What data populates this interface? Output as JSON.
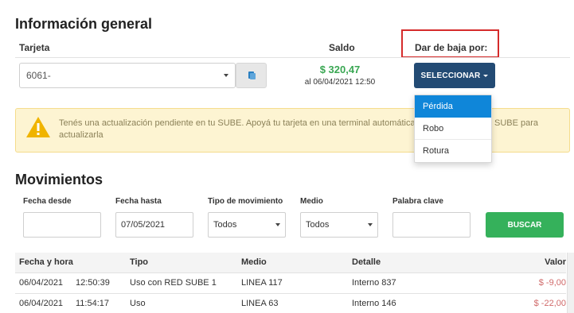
{
  "general": {
    "title": "Información general",
    "col_tarjeta": "Tarjeta",
    "col_saldo": "Saldo",
    "col_baja": "Dar de baja por:",
    "card_value": "6061-",
    "balance": "$ 320,47",
    "balance_date": "al 06/04/2021 12:50",
    "select_button": "SELECCIONAR",
    "dropdown_options": [
      "Pérdida",
      "Robo",
      "Rotura"
    ]
  },
  "alert": {
    "line1_a": "Tenés una actualización pendiente en tu SUBE. Apoyá tu tarjeta en una terminal automática",
    "line1_b": "SUBE para",
    "line2": "actualizarla"
  },
  "movimientos": {
    "title": "Movimientos",
    "filters": {
      "fecha_desde_label": "Fecha desde",
      "fecha_desde_value": "",
      "fecha_hasta_label": "Fecha hasta",
      "fecha_hasta_value": "07/05/2021",
      "tipo_label": "Tipo de movimiento",
      "tipo_value": "Todos",
      "medio_label": "Medio",
      "medio_value": "Todos",
      "palabra_label": "Palabra clave",
      "palabra_value": "",
      "buscar": "BUSCAR"
    },
    "headers": [
      "Fecha y hora",
      "Tipo",
      "Medio",
      "Detalle",
      "Valor"
    ],
    "rows": [
      {
        "fecha": "06/04/2021",
        "hora": "12:50:39",
        "tipo": "Uso con RED SUBE 1",
        "medio": "LINEA 117",
        "detalle": "Interno 837",
        "valor": "$ -9,00"
      },
      {
        "fecha": "06/04/2021",
        "hora": "11:54:17",
        "tipo": "Uso",
        "medio": "LINEA 63",
        "detalle": "Interno 146",
        "valor": "$ -22,00"
      }
    ]
  },
  "colors": {
    "select_button": "#234b74",
    "balance": "#3aa753",
    "dropdown_active": "#0f86d9",
    "buscar": "#35b15b",
    "highlight": "#d52b2b",
    "negative": "#d06a6a"
  },
  "icons": {
    "warning": "warning-triangle-icon",
    "card_action": "card-icon"
  }
}
